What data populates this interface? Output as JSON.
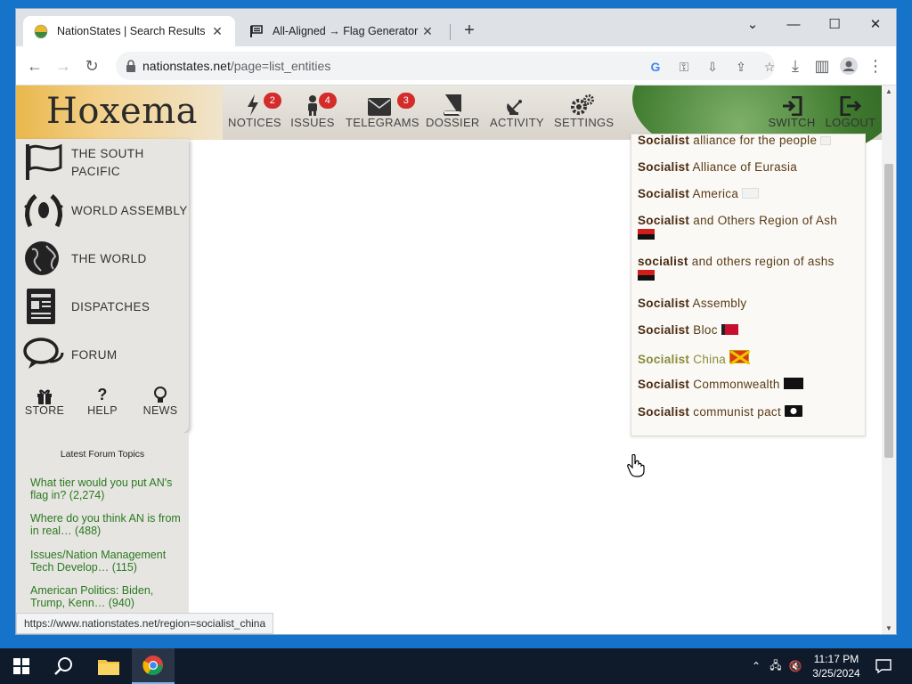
{
  "browser": {
    "tabs": [
      {
        "title": "NationStates | Search Results",
        "active": true
      },
      {
        "title": "All-Aligned → Flag Generator",
        "active": false
      }
    ],
    "url_host": "nationstates.net",
    "url_path": "/page=list_entities",
    "status_url": "https://www.nationstates.net/region=socialist_china"
  },
  "banner": {
    "nation": "Hoxema",
    "nav": [
      {
        "label": "NOTICES",
        "badge": "2"
      },
      {
        "label": "ISSUES",
        "badge": "4"
      },
      {
        "label": "TELEGRAMS",
        "badge": "3"
      },
      {
        "label": "DOSSIER",
        "badge": ""
      },
      {
        "label": "ACTIVITY",
        "badge": ""
      },
      {
        "label": "SETTINGS",
        "badge": ""
      }
    ],
    "right": [
      {
        "label": "SWITCH"
      },
      {
        "label": "LOGOUT"
      }
    ]
  },
  "sidebar": {
    "items": [
      {
        "label_line1": "THE SOUTH",
        "label_line2": "PACIFIC"
      },
      {
        "label_line1": "WORLD ASSEMBLY",
        "label_line2": ""
      },
      {
        "label_line1": "THE WORLD",
        "label_line2": ""
      },
      {
        "label_line1": "DISPATCHES",
        "label_line2": ""
      },
      {
        "label_line1": "FORUM",
        "label_line2": ""
      }
    ],
    "mini": [
      {
        "label": "STORE"
      },
      {
        "label": "HELP"
      },
      {
        "label": "NEWS"
      }
    ]
  },
  "forum": {
    "header": "Latest Forum Topics",
    "topics": [
      {
        "title": "What tier would you put AN's flag in? (2,274)"
      },
      {
        "title": "Where do you think AN is from in real… (488)"
      },
      {
        "title": "Issues/Nation Management Tech Develop… (115)"
      },
      {
        "title": "American Politics: Biden, Trump, Kenn… (940)"
      }
    ]
  },
  "results": [
    {
      "bold": "Socialist",
      "rest": " alliance for the people"
    },
    {
      "bold": "Socialist",
      "rest": " Alliance of Eurasia"
    },
    {
      "bold": "Socialist",
      "rest": " America"
    },
    {
      "bold": "Socialist",
      "rest": " and Others Region of Ash"
    },
    {
      "bold": "socialist",
      "rest": " and others region of ashs"
    },
    {
      "bold": "Socialist",
      "rest": " Assembly"
    },
    {
      "bold": "Socialist",
      "rest": " Bloc"
    },
    {
      "bold": "Socialist",
      "rest": " China"
    },
    {
      "bold": "Socialist",
      "rest": " Commonwealth"
    },
    {
      "bold": "Socialist",
      "rest": " communist pact"
    }
  ],
  "taskbar": {
    "time": "11:17 PM",
    "date": "3/25/2024"
  },
  "colors": {
    "accent_badge": "#d42b2b",
    "link_green": "#2a7a1e",
    "result_text": "#5a3b17"
  }
}
